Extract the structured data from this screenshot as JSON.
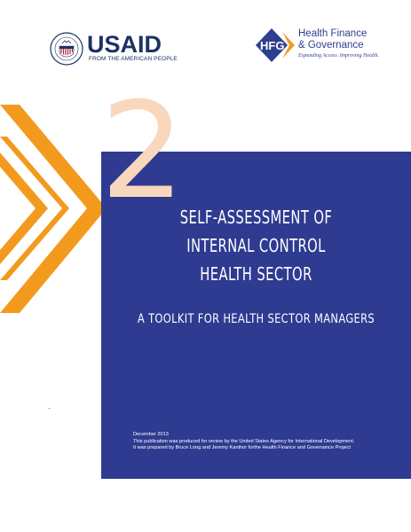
{
  "logos": {
    "usaid": {
      "name": "USAID",
      "tagline": "FROM THE AMERICAN PEOPLE"
    },
    "hfg": {
      "line1": "Health Finance",
      "line2": "& Governance",
      "tagline": "Expanding Access. Improving Health."
    }
  },
  "cover": {
    "number": "2",
    "title_lines": [
      "SELF-ASSESSMENT OF",
      "INTERNAL CONTROL",
      "HEALTH SECTOR"
    ],
    "subtitle": "A TOOLKIT FOR HEALTH SECTOR MANAGERS",
    "footer_lines": [
      "December 2013",
      "This publication was produced for review by the United States Agency for International Development.",
      "It was prepared by Bruce Long and Jeremy Kanthor forthe Health Finance and Governance Project"
    ]
  },
  "colors": {
    "panel": "#2e3b91",
    "accent_orange": "#f39a1e",
    "number_peach": "#f9d7bd",
    "usaid_navy": "#1d3264"
  }
}
